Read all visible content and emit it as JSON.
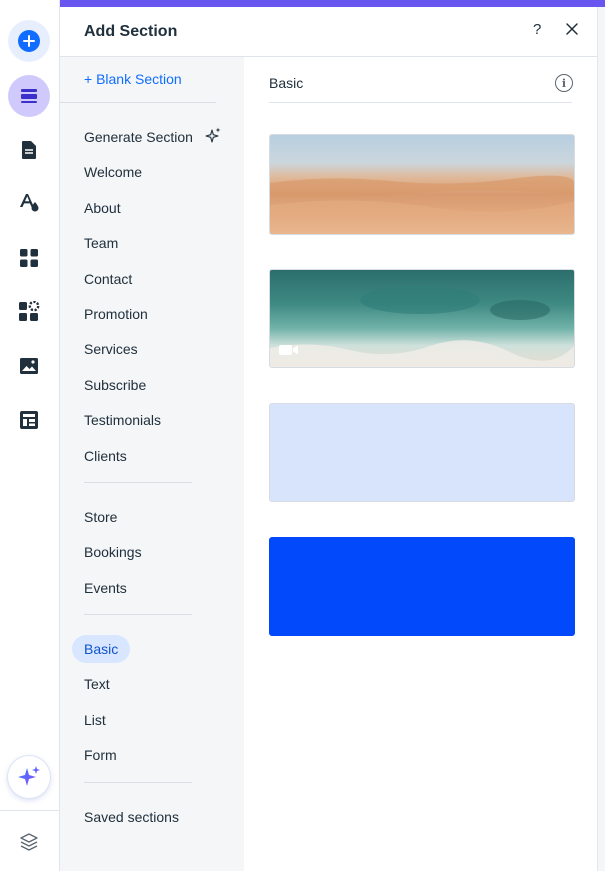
{
  "panel": {
    "title": "Add Section",
    "help_label": "?",
    "blank_section": "+ Blank Section"
  },
  "categories": {
    "group1": [
      "Generate Section",
      "Welcome",
      "About",
      "Team",
      "Contact",
      "Promotion",
      "Services",
      "Subscribe",
      "Testimonials",
      "Clients"
    ],
    "group2": [
      "Store",
      "Bookings",
      "Events"
    ],
    "group3": [
      "Basic",
      "Text",
      "List",
      "Form"
    ],
    "group4": [
      "Saved sections"
    ],
    "active": "Basic"
  },
  "preview": {
    "title": "Basic",
    "info_label": "i",
    "thumbnails": [
      {
        "name": "desert-image",
        "kind": "image"
      },
      {
        "name": "ocean-video",
        "kind": "video"
      },
      {
        "name": "light-blue-background",
        "color": "#d8e3fc"
      },
      {
        "name": "blue-background",
        "color": "#0349fc"
      }
    ]
  },
  "rail": {
    "icons": [
      "add-icon",
      "sections-icon",
      "pages-icon",
      "design-icon",
      "apps-icon",
      "add-apps-icon",
      "media-icon",
      "cms-icon",
      "ai-assistant-icon",
      "layers-icon"
    ]
  },
  "colors": {
    "accent": "#116dff",
    "top_strip": "#6956f0",
    "active_pill": "#d9e6ff"
  }
}
